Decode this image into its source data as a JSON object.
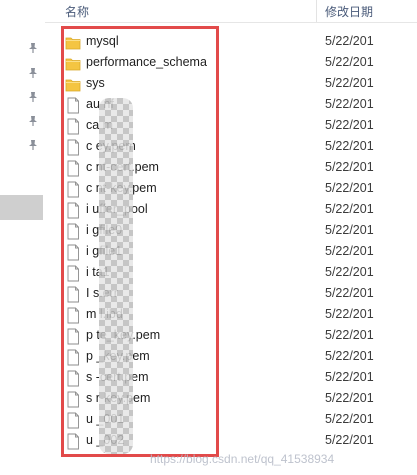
{
  "header": {
    "name_col": "名称",
    "date_col": "修改日期"
  },
  "files": [
    {
      "name": "mysql",
      "type": "folder",
      "date": "5/22/201"
    },
    {
      "name": "performance_schema",
      "type": "folder",
      "date": "5/22/201"
    },
    {
      "name": "sys",
      "type": "folder",
      "date": "5/22/201"
    },
    {
      "name": "au     nf",
      "type": "file",
      "date": "5/22/201"
    },
    {
      "name": "ca     m",
      "type": "file",
      "date": "5/22/201"
    },
    {
      "name": "c     ey.pem",
      "type": "file",
      "date": "5/22/201"
    },
    {
      "name": "c     nt-cert.pem",
      "type": "file",
      "date": "5/22/201"
    },
    {
      "name": "c     nt-key.pem",
      "type": "file",
      "date": "5/22/201"
    },
    {
      "name": "i     uffer_pool",
      "type": "file",
      "date": "5/22/201"
    },
    {
      "name": "i     gfile0",
      "type": "file",
      "date": "5/22/201"
    },
    {
      "name": "i     gfile1",
      "type": "file",
      "date": "5/22/201"
    },
    {
      "name": "i     ta1",
      "type": "file",
      "date": "5/22/201"
    },
    {
      "name": "I     s.err",
      "type": "file",
      "date": "5/22/201"
    },
    {
      "name": "m     l.ibd",
      "type": "file",
      "date": "5/22/201"
    },
    {
      "name": "p     te_key.pem",
      "type": "file",
      "date": "5/22/201"
    },
    {
      "name": "p     _key.pem",
      "type": "file",
      "date": "5/22/201"
    },
    {
      "name": "s     -cert.pem",
      "type": "file",
      "date": "5/22/201"
    },
    {
      "name": "s     r-key.pem",
      "type": "file",
      "date": "5/22/201"
    },
    {
      "name": "u     _001",
      "type": "file",
      "date": "5/22/201"
    },
    {
      "name": "u     _002",
      "type": "file",
      "date": "5/22/201"
    }
  ],
  "watermark": "https://blog.csdn.net/qq_41538934",
  "colors": {
    "highlight": "#e24a4a",
    "folder": "#f4c542",
    "header_text": "#4a5b7a"
  },
  "icons": {
    "folder": "folder-icon",
    "file": "file-icon",
    "pin": "pin-icon"
  }
}
